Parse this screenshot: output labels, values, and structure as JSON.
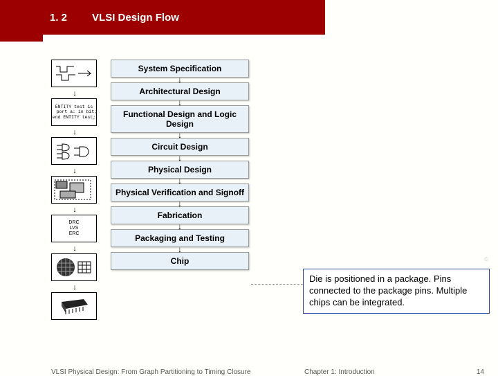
{
  "header": {
    "section": "1. 2",
    "title": "VLSI Design Flow"
  },
  "flow": {
    "steps": [
      "System Specification",
      "Architectural Design",
      "Functional Design and Logic Design",
      "Circuit Design",
      "Physical Design",
      "Physical Verification and Signoff",
      "Fabrication",
      "Packaging and Testing",
      "Chip"
    ]
  },
  "icons": {
    "entity_code": "ENTITY test is\n  port a: in bit;\nend ENTITY test;",
    "verif_lines": [
      "DRC",
      "LVS",
      "ERC"
    ]
  },
  "callout": "Die is positioned in a package. Pins connected to the package pins. Multiple chips can be integrated.",
  "footer": {
    "left": "VLSI Physical Design: From Graph Partitioning to Timing Closure",
    "center": "Chapter 1: Introduction",
    "right": "14"
  },
  "copyright": "©"
}
